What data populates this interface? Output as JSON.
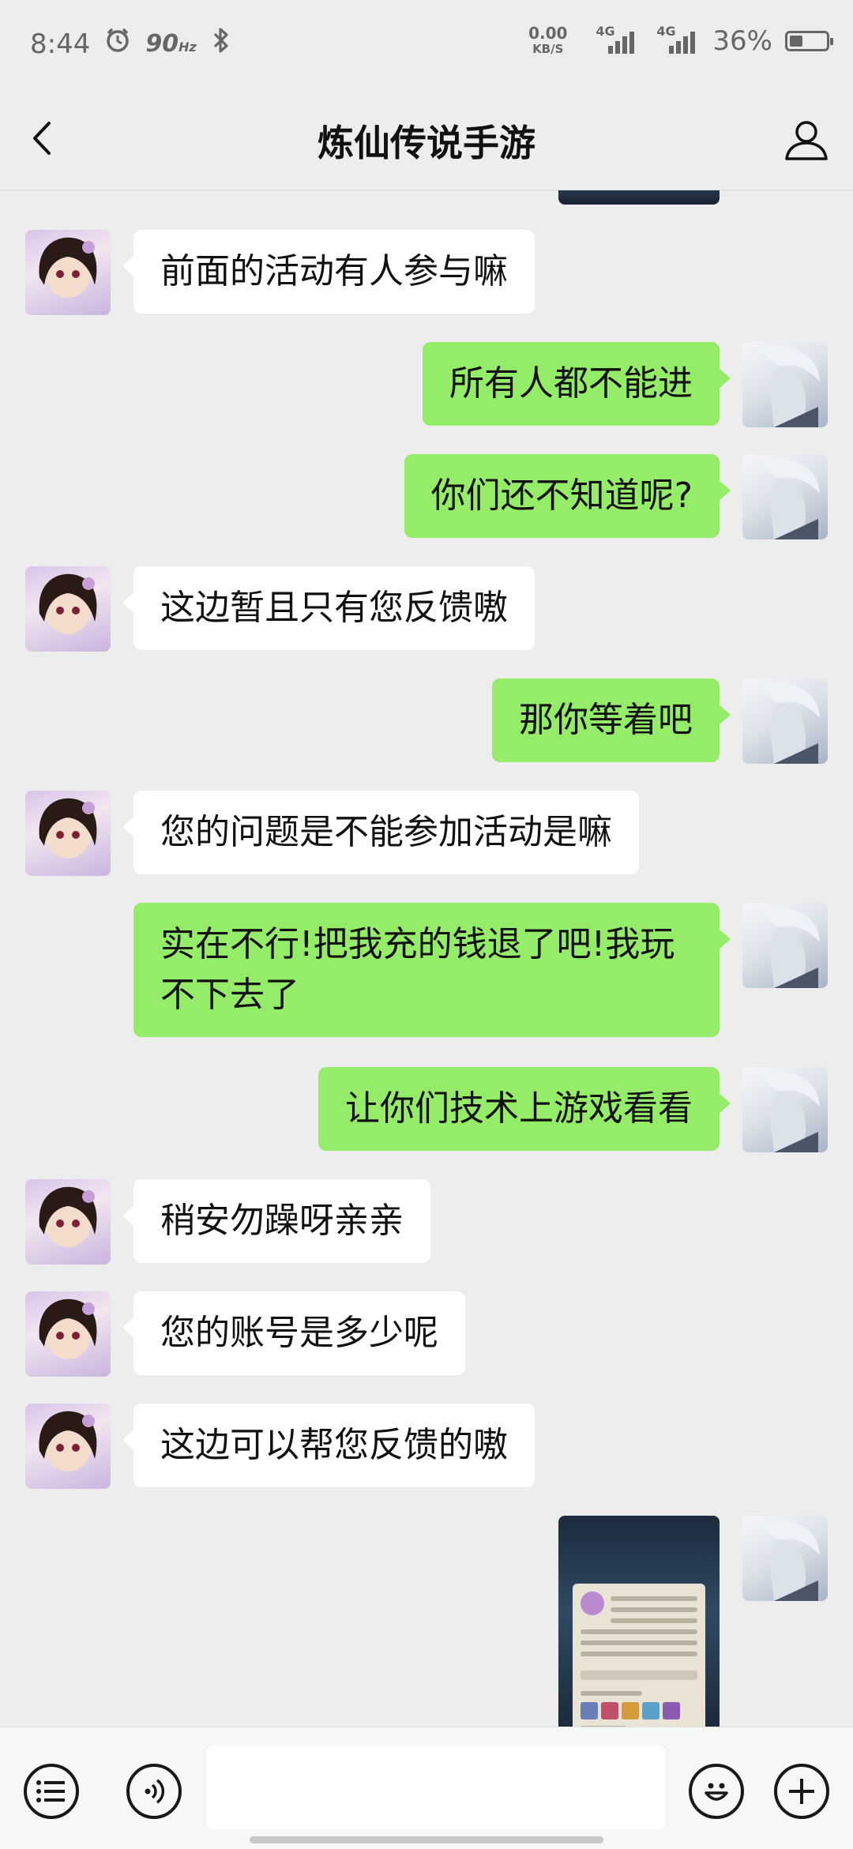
{
  "status_bar": {
    "time": "8:44",
    "refresh_rate": "90",
    "refresh_unit": "Hz",
    "net_speed_value": "0.00",
    "net_speed_unit": "KB/S",
    "signal_1_label": "4G",
    "signal_2_label": "4G",
    "battery_percent": "36%",
    "battery_level": 0.36
  },
  "header": {
    "title": "炼仙传说手游",
    "back_icon": "chevron-left-icon",
    "profile_icon": "person-icon"
  },
  "messages": [
    {
      "side": "left",
      "type": "text",
      "text": "前面的活动有人参与嘛"
    },
    {
      "side": "right",
      "type": "text",
      "text": "所有人都不能进"
    },
    {
      "side": "right",
      "type": "text",
      "text": "你们还不知道呢?"
    },
    {
      "side": "left",
      "type": "text",
      "text": "这边暂且只有您反馈嗷"
    },
    {
      "side": "right",
      "type": "text",
      "text": "那你等着吧"
    },
    {
      "side": "left",
      "type": "text",
      "text": "您的问题是不能参加活动是嘛"
    },
    {
      "side": "right",
      "type": "text",
      "text": "实在不行!把我充的钱退了吧!我玩不下去了"
    },
    {
      "side": "right",
      "type": "text",
      "text": "让你们技术上游戏看看"
    },
    {
      "side": "left",
      "type": "text",
      "text": "稍安勿躁呀亲亲"
    },
    {
      "side": "left",
      "type": "text",
      "text": "您的账号是多少呢"
    },
    {
      "side": "left",
      "type": "text",
      "text": "这边可以帮您反馈的嗷"
    },
    {
      "side": "right",
      "type": "image",
      "text": ""
    }
  ],
  "input_bar": {
    "menu_icon": "list-menu-icon",
    "voice_icon": "voice-icon",
    "input_value": "",
    "emoji_icon": "smiley-icon",
    "plus_icon": "plus-icon"
  },
  "colors": {
    "background": "#ededed",
    "sent_bubble": "#95ec69",
    "received_bubble": "#ffffff"
  }
}
